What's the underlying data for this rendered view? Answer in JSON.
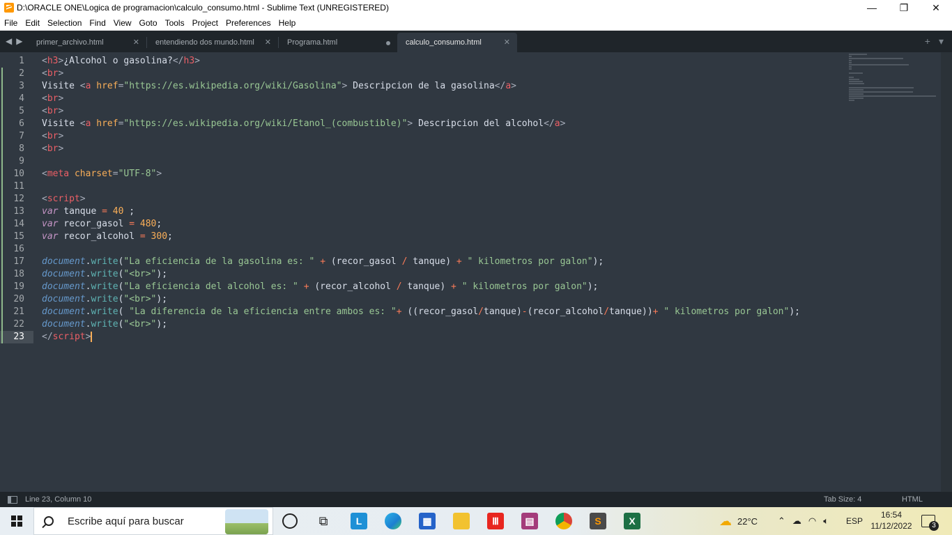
{
  "window": {
    "title": "D:\\ORACLE ONE\\Logica de programacion\\calculo_consumo.html - Sublime Text (UNREGISTERED)",
    "minimize": "—",
    "maximize": "❐",
    "close": "✕"
  },
  "menu": [
    "File",
    "Edit",
    "Selection",
    "Find",
    "View",
    "Goto",
    "Tools",
    "Project",
    "Preferences",
    "Help"
  ],
  "tabs": [
    {
      "label": "primer_archivo.html",
      "state": "close"
    },
    {
      "label": "entendiendo dos mundo.html",
      "state": "close"
    },
    {
      "label": "Programa.html",
      "state": "dirty"
    },
    {
      "label": "calculo_consumo.html",
      "state": "active"
    }
  ],
  "tab_nav": {
    "left": "◀",
    "right": "▶"
  },
  "tab_actions": {
    "add": "+",
    "list": "▾"
  },
  "editor": {
    "line_numbers": [
      "1",
      "2",
      "3",
      "4",
      "5",
      "6",
      "7",
      "8",
      "9",
      "10",
      "11",
      "12",
      "13",
      "14",
      "15",
      "16",
      "17",
      "18",
      "19",
      "20",
      "21",
      "22",
      "23"
    ],
    "lines": [
      [
        [
          "p",
          "<"
        ],
        [
          "t",
          "h3"
        ],
        [
          "p",
          ">"
        ],
        [
          "x",
          "¿Alcohol o gasolina?"
        ],
        [
          "p",
          "</"
        ],
        [
          "t",
          "h3"
        ],
        [
          "p",
          ">"
        ]
      ],
      [
        [
          "p",
          "<"
        ],
        [
          "t",
          "br"
        ],
        [
          "p",
          ">"
        ]
      ],
      [
        [
          "x",
          "Visite "
        ],
        [
          "p",
          "<"
        ],
        [
          "t",
          "a"
        ],
        [
          "x",
          " "
        ],
        [
          "a",
          "href"
        ],
        [
          "p",
          "="
        ],
        [
          "s",
          "\"https://es.wikipedia.org/wiki/Gasolina\""
        ],
        [
          "p",
          ">"
        ],
        [
          "x",
          " Descripcion de la gasolina"
        ],
        [
          "p",
          "</"
        ],
        [
          "t",
          "a"
        ],
        [
          "p",
          ">"
        ]
      ],
      [
        [
          "p",
          "<"
        ],
        [
          "t",
          "br"
        ],
        [
          "p",
          ">"
        ]
      ],
      [
        [
          "p",
          "<"
        ],
        [
          "t",
          "br"
        ],
        [
          "p",
          ">"
        ]
      ],
      [
        [
          "x",
          "Visite "
        ],
        [
          "p",
          "<"
        ],
        [
          "t",
          "a"
        ],
        [
          "x",
          " "
        ],
        [
          "a",
          "href"
        ],
        [
          "p",
          "="
        ],
        [
          "s",
          "\"https://es.wikipedia.org/wiki/Etanol_(combustible)\""
        ],
        [
          "p",
          ">"
        ],
        [
          "x",
          " Descripcion del alcohol"
        ],
        [
          "p",
          "</"
        ],
        [
          "t",
          "a"
        ],
        [
          "p",
          ">"
        ]
      ],
      [
        [
          "p",
          "<"
        ],
        [
          "t",
          "br"
        ],
        [
          "p",
          ">"
        ]
      ],
      [
        [
          "p",
          "<"
        ],
        [
          "t",
          "br"
        ],
        [
          "p",
          ">"
        ]
      ],
      [],
      [
        [
          "p",
          "<"
        ],
        [
          "t",
          "meta"
        ],
        [
          "x",
          " "
        ],
        [
          "a",
          "charset"
        ],
        [
          "p",
          "="
        ],
        [
          "s",
          "\"UTF-8\""
        ],
        [
          "p",
          ">"
        ]
      ],
      [],
      [
        [
          "p",
          "<"
        ],
        [
          "t",
          "script"
        ],
        [
          "p",
          ">"
        ]
      ],
      [
        [
          "k",
          "var"
        ],
        [
          "x",
          " tanque "
        ],
        [
          "o",
          "="
        ],
        [
          "x",
          " "
        ],
        [
          "n",
          "40"
        ],
        [
          "x",
          " ;"
        ]
      ],
      [
        [
          "k",
          "var"
        ],
        [
          "x",
          " recor_gasol "
        ],
        [
          "o",
          "="
        ],
        [
          "x",
          " "
        ],
        [
          "n",
          "480"
        ],
        [
          "x",
          ";"
        ]
      ],
      [
        [
          "k",
          "var"
        ],
        [
          "x",
          " recor_alcohol "
        ],
        [
          "o",
          "="
        ],
        [
          "x",
          " "
        ],
        [
          "n",
          "300"
        ],
        [
          "x",
          ";"
        ]
      ],
      [],
      [
        [
          "f",
          "document"
        ],
        [
          "x",
          "."
        ],
        [
          "m",
          "write"
        ],
        [
          "x",
          "("
        ],
        [
          "s",
          "\"La eficiencia de la gasolina es: \""
        ],
        [
          "x",
          " "
        ],
        [
          "o",
          "+"
        ],
        [
          "x",
          " (recor_gasol "
        ],
        [
          "o",
          "/"
        ],
        [
          "x",
          " tanque) "
        ],
        [
          "o",
          "+"
        ],
        [
          "x",
          " "
        ],
        [
          "s",
          "\" kilometros por galon\""
        ],
        [
          "x",
          ");"
        ]
      ],
      [
        [
          "f",
          "document"
        ],
        [
          "x",
          "."
        ],
        [
          "m",
          "write"
        ],
        [
          "x",
          "("
        ],
        [
          "s",
          "\"<br>\""
        ],
        [
          "x",
          ");"
        ]
      ],
      [
        [
          "f",
          "document"
        ],
        [
          "x",
          "."
        ],
        [
          "m",
          "write"
        ],
        [
          "x",
          "("
        ],
        [
          "s",
          "\"La eficiencia del alcohol es: \""
        ],
        [
          "x",
          " "
        ],
        [
          "o",
          "+"
        ],
        [
          "x",
          " (recor_alcohol "
        ],
        [
          "o",
          "/"
        ],
        [
          "x",
          " tanque) "
        ],
        [
          "o",
          "+"
        ],
        [
          "x",
          " "
        ],
        [
          "s",
          "\" kilometros por galon\""
        ],
        [
          "x",
          ");"
        ]
      ],
      [
        [
          "f",
          "document"
        ],
        [
          "x",
          "."
        ],
        [
          "m",
          "write"
        ],
        [
          "x",
          "("
        ],
        [
          "s",
          "\"<br>\""
        ],
        [
          "x",
          ");"
        ]
      ],
      [
        [
          "f",
          "document"
        ],
        [
          "x",
          "."
        ],
        [
          "m",
          "write"
        ],
        [
          "x",
          "( "
        ],
        [
          "s",
          "\"La diferencia de la eficiencia entre ambos es: \""
        ],
        [
          "o",
          "+"
        ],
        [
          "x",
          " ((recor_gasol"
        ],
        [
          "o",
          "/"
        ],
        [
          "x",
          "tanque)"
        ],
        [
          "o",
          "-"
        ],
        [
          "x",
          "(recor_alcohol"
        ],
        [
          "o",
          "/"
        ],
        [
          "x",
          "tanque))"
        ],
        [
          "o",
          "+"
        ],
        [
          "x",
          " "
        ],
        [
          "s",
          "\" kilometros por galon\""
        ],
        [
          "x",
          ");"
        ]
      ],
      [
        [
          "f",
          "document"
        ],
        [
          "x",
          "."
        ],
        [
          "m",
          "write"
        ],
        [
          "x",
          "("
        ],
        [
          "s",
          "\"<br>\""
        ],
        [
          "x",
          ");"
        ]
      ],
      [
        [
          "p",
          "</"
        ],
        [
          "t",
          "script"
        ],
        [
          "p",
          ">"
        ]
      ]
    ],
    "current_line": 23,
    "modified_from": 2
  },
  "status": {
    "position": "Line 23, Column 10",
    "tab_size": "Tab Size: 4",
    "syntax": "HTML"
  },
  "taskbar": {
    "search_placeholder": "Escribe aquí para buscar",
    "weather": "22°C",
    "lang": "ESP",
    "time": "16:54",
    "date": "11/12/2022",
    "notifications": "3"
  },
  "colors": {
    "editor_bg": "#303841",
    "tab_bg": "#1f252a",
    "accent": "#f9ae58"
  }
}
